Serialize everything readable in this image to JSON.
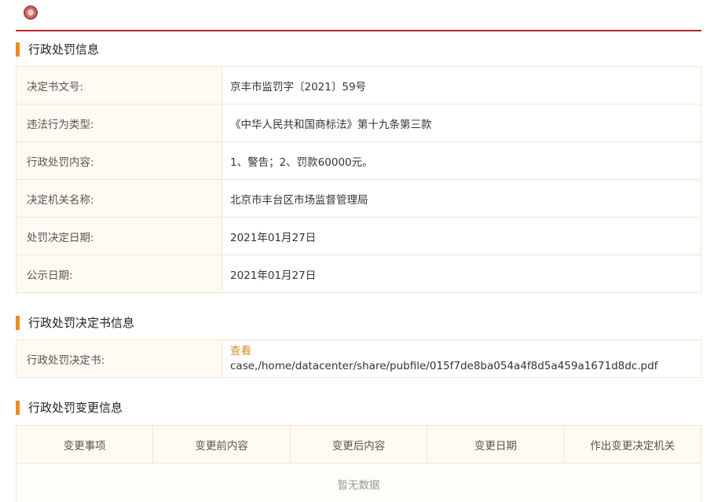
{
  "sections": {
    "penalty_info": {
      "title": "行政处罚信息"
    },
    "decision_doc": {
      "title": "行政处罚决定书信息"
    },
    "change_info": {
      "title": "行政处罚变更信息"
    }
  },
  "penalty_info": {
    "rows": [
      {
        "label": "决定书文号:",
        "value": "京丰市监罚字〔2021〕59号"
      },
      {
        "label": "违法行为类型:",
        "value": "《中华人民共和国商标法》第十九条第三款"
      },
      {
        "label": "行政处罚内容:",
        "value": "1、警告；2、罚款60000元。"
      },
      {
        "label": "决定机关名称:",
        "value": "北京市丰台区市场监督管理局"
      },
      {
        "label": "处罚决定日期:",
        "value": "2021年01月27日"
      },
      {
        "label": "公示日期:",
        "value": "2021年01月27日"
      }
    ]
  },
  "decision_doc": {
    "label": "行政处罚决定书:",
    "link_text": "查看",
    "path": "case,/home/datacenter/share/pubfile/015f7de8ba054a4f8d5a459a1671d8dc.pdf"
  },
  "change_info": {
    "columns": [
      "变更事项",
      "变更前内容",
      "变更后内容",
      "变更日期",
      "作出变更决定机关"
    ],
    "empty_text": "暂无数据"
  },
  "colors": {
    "accent_red": "#b32a2a",
    "section_marker": "#ee8a1f",
    "link": "#d09225",
    "cell_bg": "#fffbf2",
    "border": "#f3e6cf"
  },
  "icons": {
    "top_left": "seal-icon"
  }
}
